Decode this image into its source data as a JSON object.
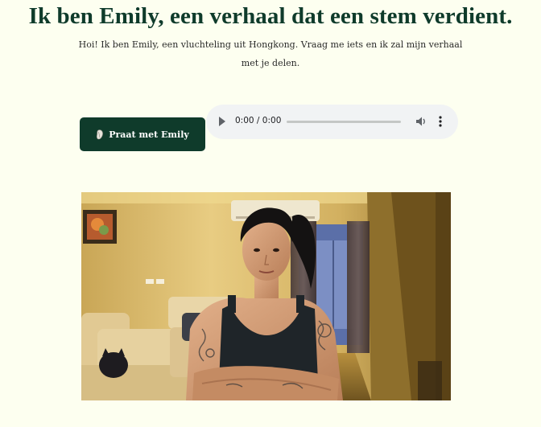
{
  "page": {
    "title": "Ik ben Emily, een verhaal dat een stem verdient.",
    "intro_line1": "Hoi! Ik ben Emily, een vluchteling uit Hongkong. Vraag me iets en ik zal mijn verhaal",
    "intro_line2": "met je delen."
  },
  "talk_button": {
    "label": "Praat met Emily",
    "icon": "microphone-icon"
  },
  "audio_player": {
    "time": "0:00 / 0:00",
    "progress": 0,
    "icons": [
      "play-icon",
      "volume-icon",
      "more-options-icon"
    ]
  },
  "video": {
    "scene": "woman in black tank top with tattooed arms in a small apartment room",
    "icons": [
      "picture-frame",
      "air-conditioner",
      "sofa",
      "window-curtain"
    ]
  },
  "colors": {
    "background": "#fdfff0",
    "accent": "#0f3b2b",
    "player_bg": "#f1f3f4"
  }
}
